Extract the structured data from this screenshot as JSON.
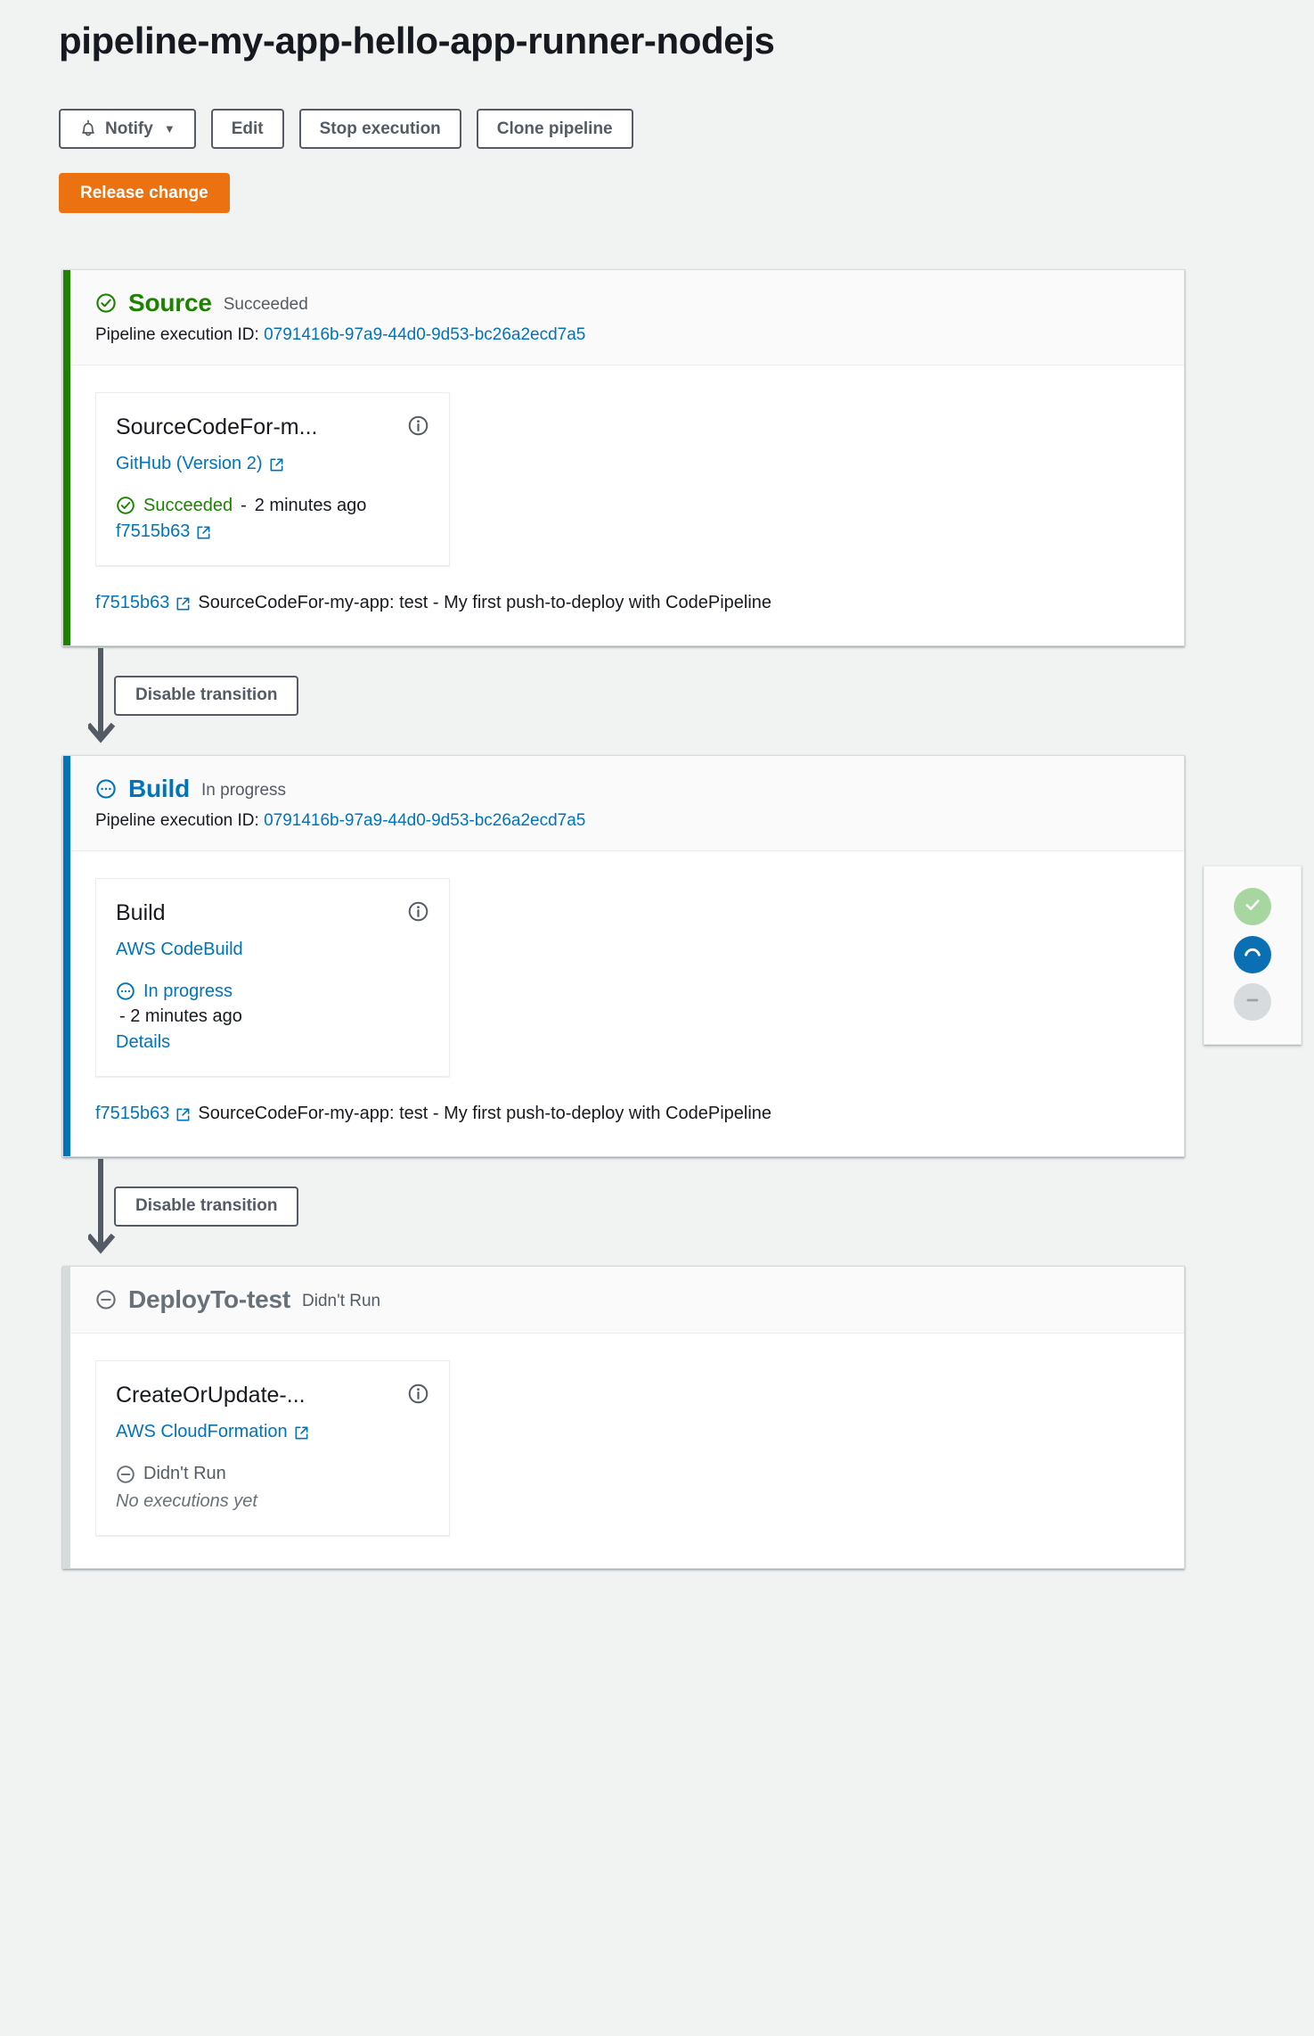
{
  "header": {
    "title": "pipeline-my-app-hello-app-runner-nodejs",
    "buttons": {
      "notify": "Notify",
      "notify_caret": "▼",
      "edit": "Edit",
      "stop_execution": "Stop execution",
      "clone_pipeline": "Clone pipeline",
      "release_change": "Release change"
    }
  },
  "labels": {
    "pipeline_execution_id": "Pipeline execution ID:",
    "disable_transition": "Disable transition",
    "dash": "-"
  },
  "colors": {
    "success_green": "#1d8102",
    "in_progress_blue": "#0073bb",
    "idle_gray": "#687078",
    "accent_orange": "#ec7211",
    "link_blue": "#0073bb",
    "page_bg": "#f1f3f3",
    "legend_success": "#a8d6a0",
    "legend_running": "#0a6fb3",
    "legend_skipped": "#d8dbdd"
  },
  "stages": [
    {
      "name": "Source",
      "status": "Succeeded",
      "state": "ok",
      "execution_id": "0791416b-97a9-44d0-9d53-bc26a2ecd7a5",
      "action": {
        "name": "SourceCodeFor-m...",
        "provider": "GitHub (Version 2)",
        "provider_external": true,
        "status": "Succeeded",
        "status_state": "ok",
        "time": "2 minutes ago",
        "time_inline": true,
        "link": "f7515b63",
        "link_external": true,
        "no_executions": ""
      },
      "commit": {
        "sha": "f7515b63",
        "message": "SourceCodeFor-my-app: test - My first push-to-deploy with CodePipeline"
      }
    },
    {
      "name": "Build",
      "status": "In progress",
      "state": "progress",
      "execution_id": "0791416b-97a9-44d0-9d53-bc26a2ecd7a5",
      "action": {
        "name": "Build",
        "provider": "AWS CodeBuild",
        "provider_external": false,
        "status": "In progress",
        "status_state": "progress",
        "time": "- 2 minutes ago",
        "time_inline": false,
        "link": "Details",
        "link_external": false,
        "no_executions": ""
      },
      "commit": {
        "sha": "f7515b63",
        "message": "SourceCodeFor-my-app: test - My first push-to-deploy with CodePipeline"
      }
    },
    {
      "name": "DeployTo-test",
      "status": "Didn't Run",
      "state": "idle",
      "execution_id": "",
      "action": {
        "name": "CreateOrUpdate-...",
        "provider": "AWS CloudFormation",
        "provider_external": true,
        "status": "Didn't Run",
        "status_state": "idle",
        "time": "",
        "time_inline": true,
        "link": "",
        "link_external": false,
        "no_executions": "No executions yet"
      },
      "commit": null
    }
  ],
  "status_legend": {
    "items": [
      {
        "icon": "check-icon",
        "state": "succeeded"
      },
      {
        "icon": "spinner-arc-icon",
        "state": "running"
      },
      {
        "icon": "minus-icon",
        "state": "skipped"
      }
    ]
  }
}
